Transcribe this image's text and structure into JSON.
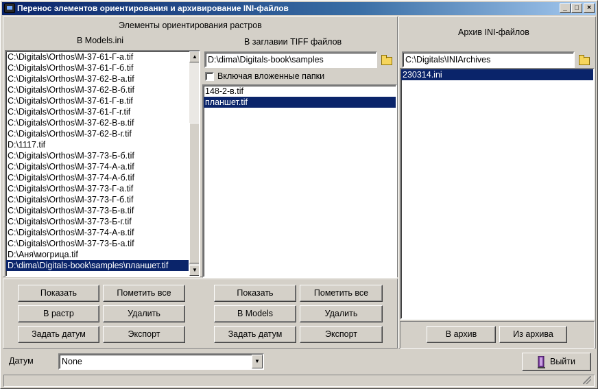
{
  "window": {
    "title": "Перенос элементов ориентирования и архивирование INI-файлов"
  },
  "left_section": {
    "heading": "Элементы ориентирования растров",
    "models_label": "В Models.ini",
    "models_list": [
      "C:\\Digitals\\Orthos\\M-37-61-Г-а.tif",
      "C:\\Digitals\\Orthos\\M-37-61-Г-б.tif",
      "C:\\Digitals\\Orthos\\M-37-62-В-а.tif",
      "C:\\Digitals\\Orthos\\M-37-62-В-б.tif",
      "C:\\Digitals\\Orthos\\M-37-61-Г-в.tif",
      "C:\\Digitals\\Orthos\\M-37-61-Г-г.tif",
      "C:\\Digitals\\Orthos\\M-37-62-В-в.tif",
      "C:\\Digitals\\Orthos\\M-37-62-В-г.tif",
      "D:\\1117.tif",
      "C:\\Digitals\\Orthos\\M-37-73-Б-б.tif",
      "C:\\Digitals\\Orthos\\M-37-74-А-а.tif",
      "C:\\Digitals\\Orthos\\M-37-74-А-б.tif",
      "C:\\Digitals\\Orthos\\M-37-73-Г-а.tif",
      "C:\\Digitals\\Orthos\\M-37-73-Г-б.tif",
      "C:\\Digitals\\Orthos\\M-37-73-Б-в.tif",
      "C:\\Digitals\\Orthos\\M-37-73-Б-г.tif",
      "C:\\Digitals\\Orthos\\M-37-74-А-в.tif",
      "C:\\Digitals\\Orthos\\M-37-73-Б-а.tif",
      "D:\\Аня\\могрица.tif",
      "D:\\dima\\Digitals-book\\samples\\планшет.tif"
    ],
    "models_selected_index": 19,
    "tiff_label": "В заглавии TIFF файлов",
    "tiff_path": "D:\\dima\\Digitals-book\\samples",
    "include_subfolders_label": "Включая вложенные папки",
    "include_subfolders_checked": false,
    "tiff_list": [
      "148-2-в.tif",
      "планшет.tif"
    ],
    "tiff_selected_index": 1
  },
  "left_buttons": {
    "show": "Показать",
    "mark_all": "Пометить все",
    "to_raster": "В растр",
    "delete": "Удалить",
    "set_datum": "Задать датум",
    "export": "Экспорт"
  },
  "mid_buttons": {
    "show": "Показать",
    "mark_all": "Пометить все",
    "to_models": "В Models",
    "delete": "Удалить",
    "set_datum": "Задать датум",
    "export": "Экспорт"
  },
  "archive": {
    "heading": "Архив INI-файлов",
    "path": "C:\\Digitals\\INIArchives",
    "list": [
      "230314.ini"
    ],
    "selected_index": 0,
    "to_archive": "В архив",
    "from_archive": "Из архива"
  },
  "bottom": {
    "datum_label": "Датум",
    "datum_value": "None",
    "exit_label": "Выйти"
  }
}
